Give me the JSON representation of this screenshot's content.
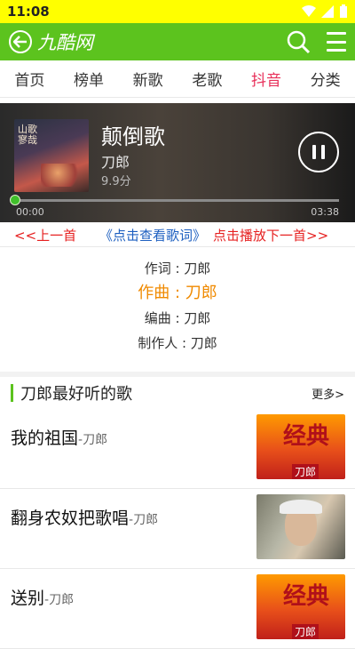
{
  "status_bar": {
    "time": "11:08"
  },
  "app_bar": {
    "title": "九酷网",
    "back_icon": "back-arrow-circle-icon",
    "search_icon": "search-icon",
    "menu_icon": "menu-icon"
  },
  "tabs": [
    {
      "label": "首页",
      "active": false
    },
    {
      "label": "榜单",
      "active": false
    },
    {
      "label": "新歌",
      "active": false
    },
    {
      "label": "老歌",
      "active": false
    },
    {
      "label": "抖音",
      "active": true
    },
    {
      "label": "分类",
      "active": false
    }
  ],
  "player": {
    "song_title": "颠倒歌",
    "artist": "刀郎",
    "score": "9.9分",
    "time_current": "00:00",
    "time_total": "03:38",
    "progress_fraction": 0.0,
    "cover_text": "山歌寥哉"
  },
  "controls": {
    "prev": "<<上一首",
    "lyrics": "《点击查看歌词》",
    "next": "点击播放下一首>>"
  },
  "credits": {
    "lyricist": "作词 : 刀郎",
    "composer": "作曲 : 刀郎",
    "arranger": "编曲 : 刀郎",
    "producer": "制作人 : 刀郎"
  },
  "section": {
    "title": "刀郎最好听的歌",
    "more": "更多>"
  },
  "songs": [
    {
      "title": "我的祖国",
      "artist": "-刀郎",
      "thumb": "classic"
    },
    {
      "title": "翻身农奴把歌唱",
      "artist": "-刀郎",
      "thumb": "photo"
    },
    {
      "title": "送别",
      "artist": "-刀郎",
      "thumb": "classic"
    }
  ],
  "thumb_classic": {
    "big": "经典",
    "small": "刀郎"
  },
  "colors": {
    "status_bar": "#ffff00",
    "app_bar": "#5cc31e",
    "active_tab": "#e8305a",
    "nav_red": "#e62020",
    "lyrics_blue": "#1d5fc0",
    "composer_orange": "#f08a00"
  }
}
